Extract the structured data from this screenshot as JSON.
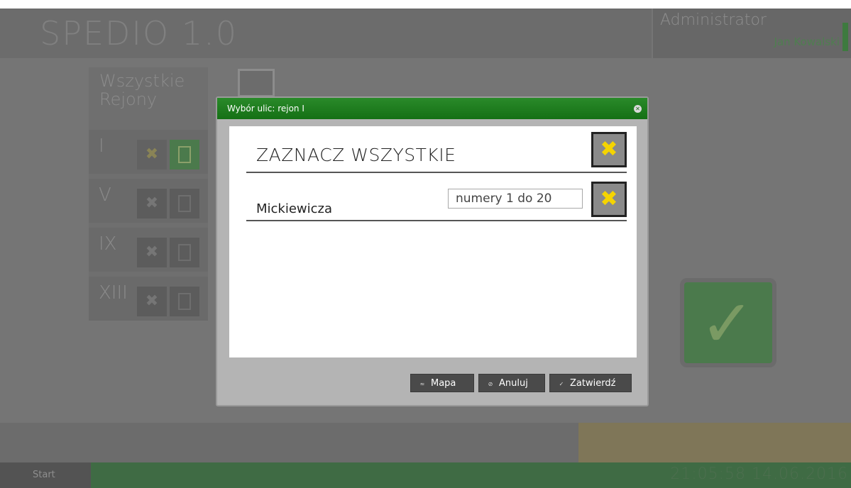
{
  "app": {
    "title": "SPEDIO 1.0",
    "user_role": "Administrator",
    "user_name": "Jan Kowalski"
  },
  "regions": {
    "all_label": "Wszystkie Rejony",
    "items": [
      {
        "label": "I",
        "active": true
      },
      {
        "label": "V",
        "active": false
      },
      {
        "label": "IX",
        "active": false
      },
      {
        "label": "XIII",
        "active": false
      }
    ]
  },
  "taskbar": {
    "start_label": "Start",
    "clock": "21:05:58 14.06.2016"
  },
  "dialog": {
    "title": "Wybór ulic: rejon I",
    "close_glyph": "✕",
    "select_all_label": "ZAZNACZ WSZYSTKIE",
    "x_glyph": "✖",
    "streets": [
      {
        "name": "Mickiewicza",
        "numbers": "numery 1 do 20"
      }
    ],
    "buttons": {
      "map": "Mapa",
      "cancel": "Anuluj",
      "confirm": "Zatwierdź"
    }
  },
  "icons": {
    "map": "map-icon",
    "cancel": "cancel-icon",
    "confirm": "check-icon"
  },
  "colors": {
    "header_green": "#1f801f",
    "x_yellow": "#f5d400",
    "button_dark": "#4a4a4a"
  }
}
